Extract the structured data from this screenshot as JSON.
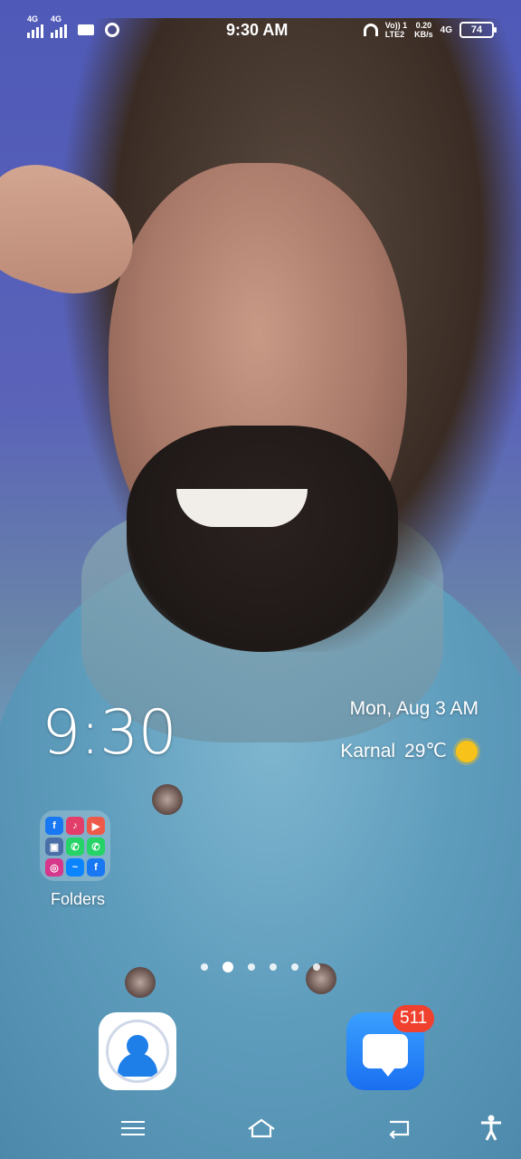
{
  "status_bar": {
    "time": "9:30 AM",
    "net1": "4G",
    "net2": "4G",
    "volte": "Vo)) 1\nLTE2",
    "speed": "0.20\nKB/s",
    "net3": "4G",
    "battery": "74"
  },
  "clock_widget": {
    "time": "9:30",
    "date": "Mon, Aug 3 AM",
    "city": "Karnal",
    "temperature": "29℃",
    "weather_icon": "sun-icon"
  },
  "folder": {
    "label": "Folders",
    "apps": [
      "facebook-icon",
      "music-icon",
      "video-icon",
      "gallery-icon",
      "whatsapp-icon",
      "whatsapp-business-icon",
      "instagram-icon",
      "messenger-icon",
      "facebook-lite-icon"
    ]
  },
  "page_indicator": {
    "count": 6,
    "active": 1
  },
  "dock": {
    "apps": [
      "contacts-icon",
      "messages-icon"
    ],
    "messages_badge": "511"
  },
  "nav_bar": {
    "buttons": [
      "menu-icon",
      "home-icon",
      "back-icon",
      "accessibility-icon"
    ]
  },
  "colors": {
    "badge": "#f0412f",
    "messages_blue": "#1a6ff0",
    "contacts_blue": "#1f7fe8",
    "sun": "#f7c21a"
  }
}
